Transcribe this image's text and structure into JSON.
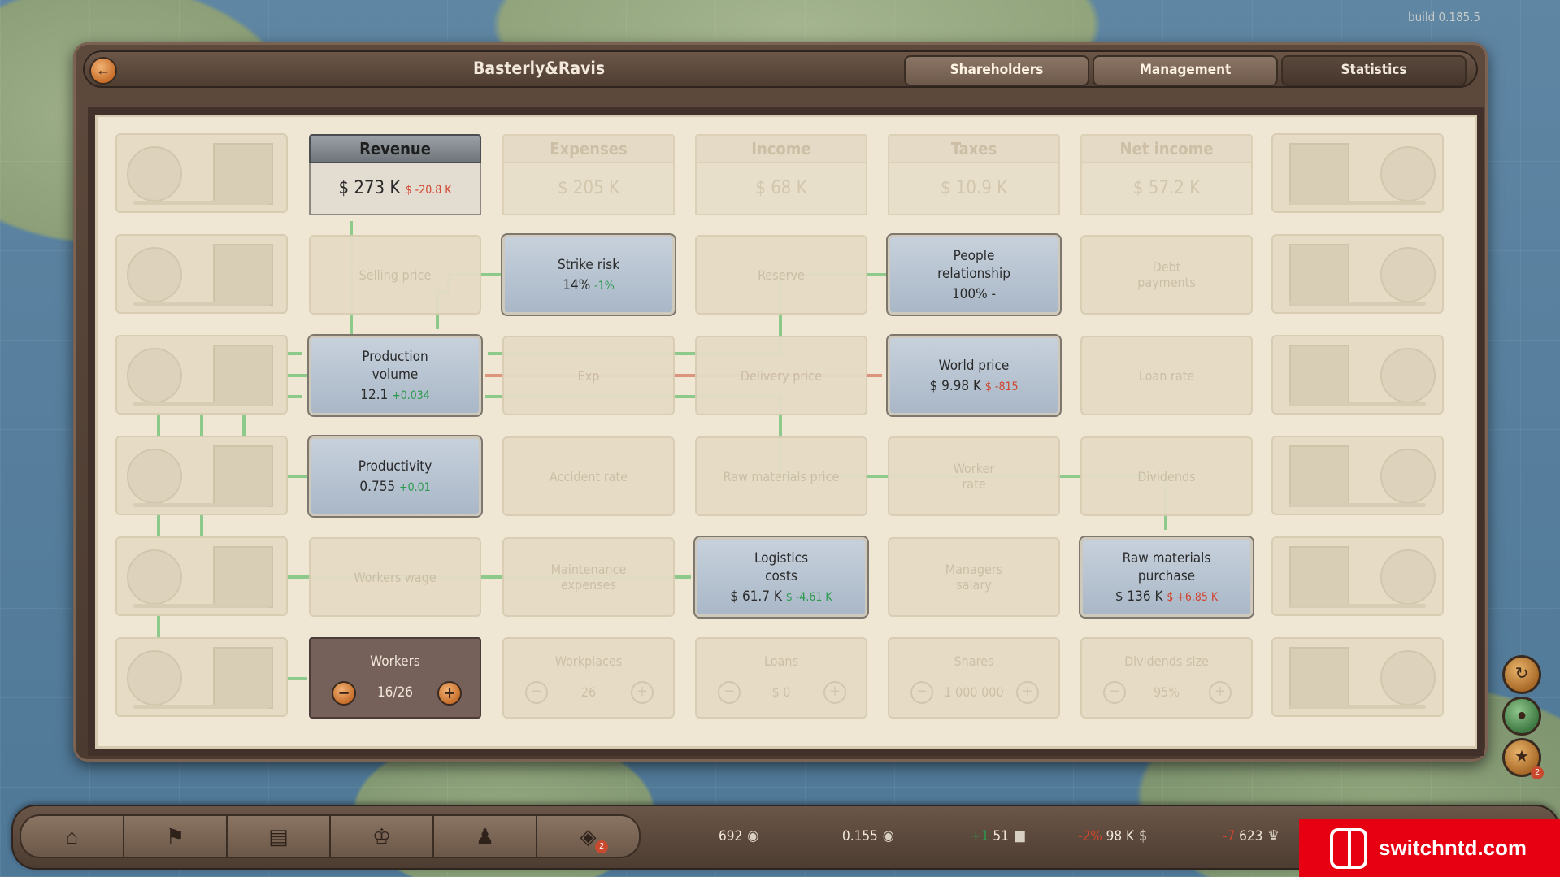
{
  "build": "build 0.185.5",
  "company": "Basterly&Ravis",
  "tabs": [
    "Shareholders",
    "Management",
    "Statistics"
  ],
  "top_row": [
    {
      "title": "Revenue",
      "value": "$ 273 K",
      "delta": "$ -20.8 K",
      "active": true
    },
    {
      "title": "Expenses",
      "value": "$ 205 K",
      "active": false
    },
    {
      "title": "Income",
      "value": "$ 68 K",
      "active": false
    },
    {
      "title": "Taxes",
      "value": "$ 10.9 K",
      "active": false
    },
    {
      "title": "Net income",
      "value": "$ 57.2 K",
      "active": false
    }
  ],
  "cards": {
    "selling_price": "Selling price",
    "strike_risk": {
      "title": "Strike risk",
      "value": "14%",
      "delta": "-1%"
    },
    "reserve": "Reserve",
    "people_relationship": {
      "title": "People relationship",
      "value": "100% -"
    },
    "debt_payments": "Debt payments",
    "production_volume": {
      "title": "Production volume",
      "value": "12.1",
      "delta": "+0.034"
    },
    "exp": "Exp",
    "delivery_price": "Delivery price",
    "world_price": {
      "title": "World price",
      "value": "$ 9.98 K",
      "delta": "$ -815"
    },
    "loan_rate": "Loan rate",
    "productivity": {
      "title": "Productivity",
      "value": "0.755",
      "delta": "+0.01"
    },
    "accident_rate": "Accident rate",
    "raw_materials_price": "Raw materials price",
    "worker_rate": "Worker rate",
    "dividends": "Dividends",
    "workers_wage": "Workers wage",
    "maintenance_expenses": "Maintenance expenses",
    "logistics_costs": {
      "title": "Logistics costs",
      "value": "$ 61.7 K",
      "delta": "$ -4.61 K"
    },
    "managers_salary": "Managers salary",
    "raw_materials_purchase": {
      "title": "Raw materials purchase",
      "value": "$ 136 K",
      "delta": "$ +6.85 K"
    }
  },
  "workers": {
    "title": "Workers",
    "value": "16/26"
  },
  "steppers": [
    {
      "title": "Workplaces",
      "value": "26"
    },
    {
      "title": "Loans",
      "value": "$ 0"
    },
    {
      "title": "Shares",
      "value": "1 000 000"
    },
    {
      "title": "Dividends size",
      "value": "95%"
    }
  ],
  "bottom": {
    "nav_icons": [
      "factory-icon",
      "map-icon",
      "government-icon",
      "trophy-icon",
      "agent-icon",
      "research-icon"
    ],
    "research_badge": "2",
    "stats": [
      {
        "value": "692",
        "icon": "coins-icon"
      },
      {
        "value": "0.155",
        "icon": "coins-icon"
      },
      {
        "delta": "+1",
        "value": "51",
        "icon": "hat-icon"
      },
      {
        "delta": "-2%",
        "value": "98 K",
        "icon": "dollar-icon"
      },
      {
        "delta": "-7",
        "value": "623",
        "icon": "crown-icon"
      }
    ],
    "side_badge": "2"
  },
  "watermark": "switchntd.com",
  "colors": {
    "link_green": "#7cc47f",
    "link_red": "#d9866f",
    "accent": "#c86f2b"
  }
}
